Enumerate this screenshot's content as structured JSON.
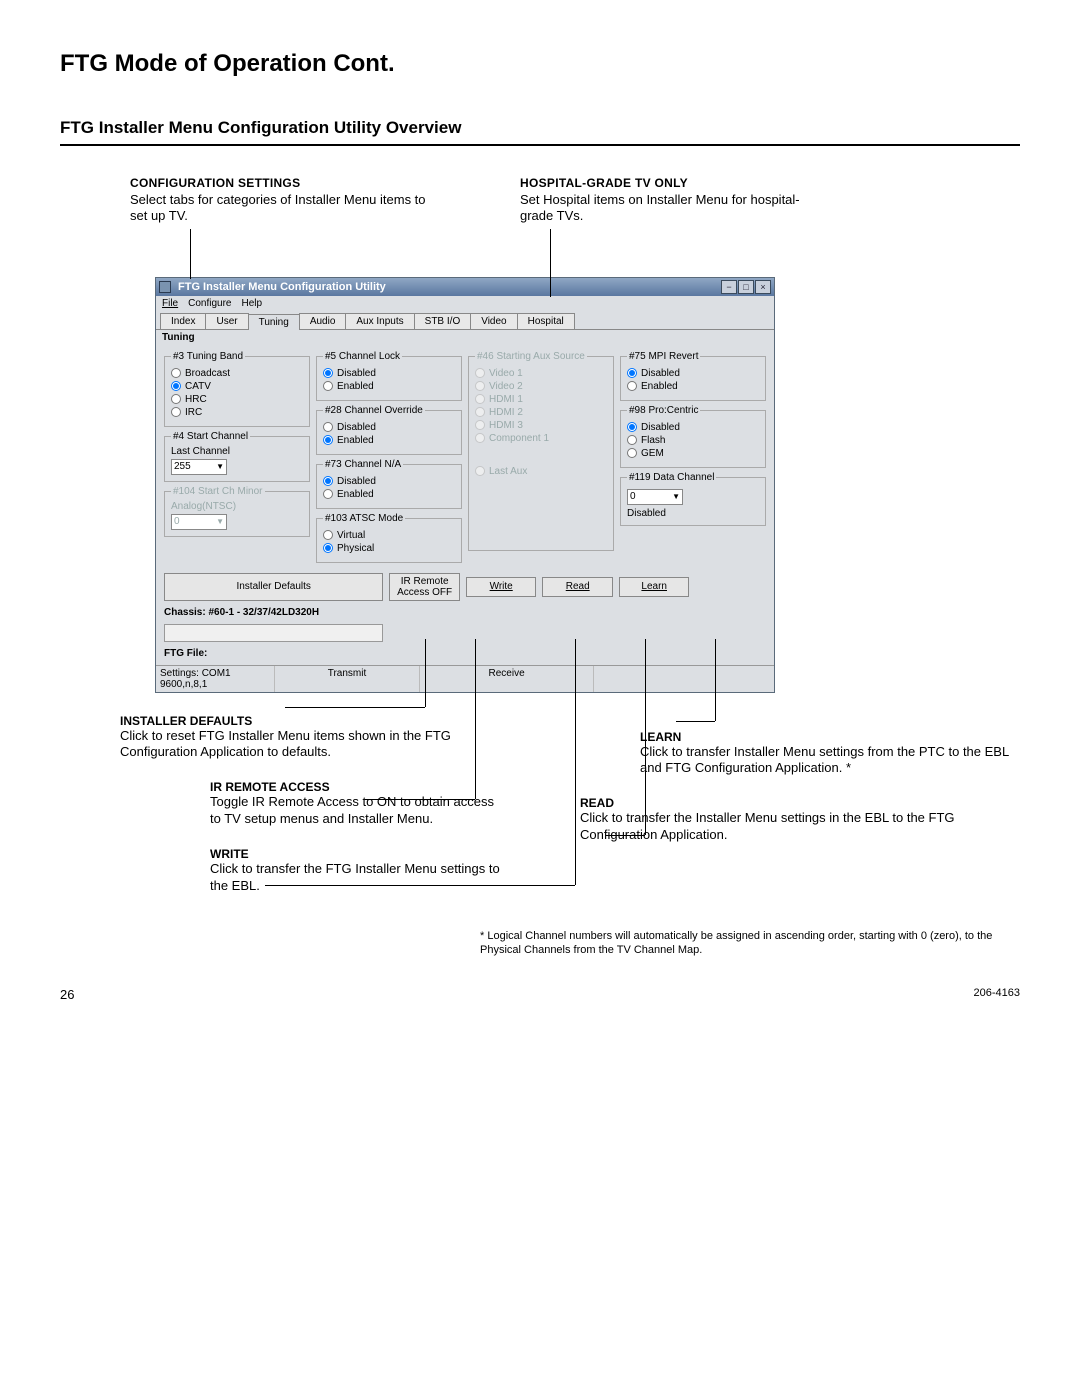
{
  "page": {
    "title": "FTG Mode of Operation Cont.",
    "section_title": "FTG Installer Menu Configuration Utility Overview",
    "page_number": "26",
    "doc_number": "206-4163",
    "footnote": "* Logical Channel numbers will automatically be assigned in ascending order, starting with 0 (zero), to the Physical Channels from the TV Channel Map."
  },
  "callouts": {
    "config": {
      "title": "CONFIGURATION SETTINGS",
      "body": "Select tabs for categories of Installer Menu items to set up TV."
    },
    "hospital": {
      "title": "HOSPITAL-GRADE TV ONLY",
      "body": "Set Hospital items on Installer Menu for hospital-grade TVs."
    },
    "installer_defaults": {
      "title": "INSTALLER DEFAULTS",
      "body": "Click to reset FTG Installer Menu items shown in the FTG Configuration Application to defaults."
    },
    "ir_remote": {
      "title": "IR REMOTE ACCESS",
      "body": "Toggle IR Remote Access to ON to obtain access to TV setup menus and Installer Menu."
    },
    "write": {
      "title": "WRITE",
      "body": "Click to transfer the FTG Installer Menu settings to the EBL."
    },
    "learn": {
      "title": "LEARN",
      "body": "Click to transfer Installer Menu settings from the PTC to the EBL and FTG Configuration Application. *"
    },
    "read": {
      "title": "READ",
      "body": "Click to transfer the Installer Menu settings in the EBL to the FTG Configuration Application."
    }
  },
  "window": {
    "title": "FTG Installer Menu Configuration Utility",
    "menubar": [
      "File",
      "Configure",
      "Help"
    ],
    "tabs": [
      "Index",
      "User",
      "Tuning",
      "Audio",
      "Aux Inputs",
      "STB I/O",
      "Video",
      "Hospital"
    ],
    "active_tab_label": "Tuning",
    "groups": {
      "tuning_band": {
        "legend": "#3 Tuning Band",
        "options": [
          "Broadcast",
          "CATV",
          "HRC",
          "IRC"
        ],
        "selected": "CATV"
      },
      "start_channel": {
        "legend": "#4 Start Channel",
        "label": "Last Channel",
        "value": "255"
      },
      "start_ch_minor": {
        "legend": "#104 Start Ch Minor",
        "label": "Analog(NTSC)",
        "value": "0"
      },
      "channel_lock": {
        "legend": "#5 Channel Lock",
        "options": [
          "Disabled",
          "Enabled"
        ],
        "selected": "Disabled"
      },
      "channel_override": {
        "legend": "#28 Channel Override",
        "options": [
          "Disabled",
          "Enabled"
        ],
        "selected": "Enabled"
      },
      "channel_na": {
        "legend": "#73 Channel N/A",
        "options": [
          "Disabled",
          "Enabled"
        ],
        "selected": "Disabled"
      },
      "atsc_mode": {
        "legend": "#103 ATSC Mode",
        "options": [
          "Virtual",
          "Physical"
        ],
        "selected": "Physical"
      },
      "start_aux_src": {
        "legend": "#46 Starting Aux Source",
        "options": [
          "Video 1",
          "Video 2",
          "HDMI 1",
          "HDMI 2",
          "HDMI 3",
          "Component 1",
          "Last Aux"
        ]
      },
      "mpi_revert": {
        "legend": "#75 MPI Revert",
        "options": [
          "Disabled",
          "Enabled"
        ],
        "selected": "Disabled"
      },
      "procentric": {
        "legend": "#98 Pro:Centric",
        "options": [
          "Disabled",
          "Flash",
          "GEM"
        ],
        "selected": "Disabled"
      },
      "data_channel": {
        "legend": "#119 Data Channel",
        "value": "0",
        "status": "Disabled"
      }
    },
    "status": {
      "chassis": "Chassis: #60-1 - 32/37/42LD320H",
      "ftg_file": "FTG File:",
      "settings": "Settings: COM1 9600,n,8,1",
      "transmit": "Transmit",
      "receive": "Receive"
    },
    "buttons": {
      "installer_defaults": "Installer Defaults",
      "ir_remote": "IR Remote Access OFF",
      "write": "Write",
      "read": "Read",
      "learn": "Learn"
    }
  }
}
